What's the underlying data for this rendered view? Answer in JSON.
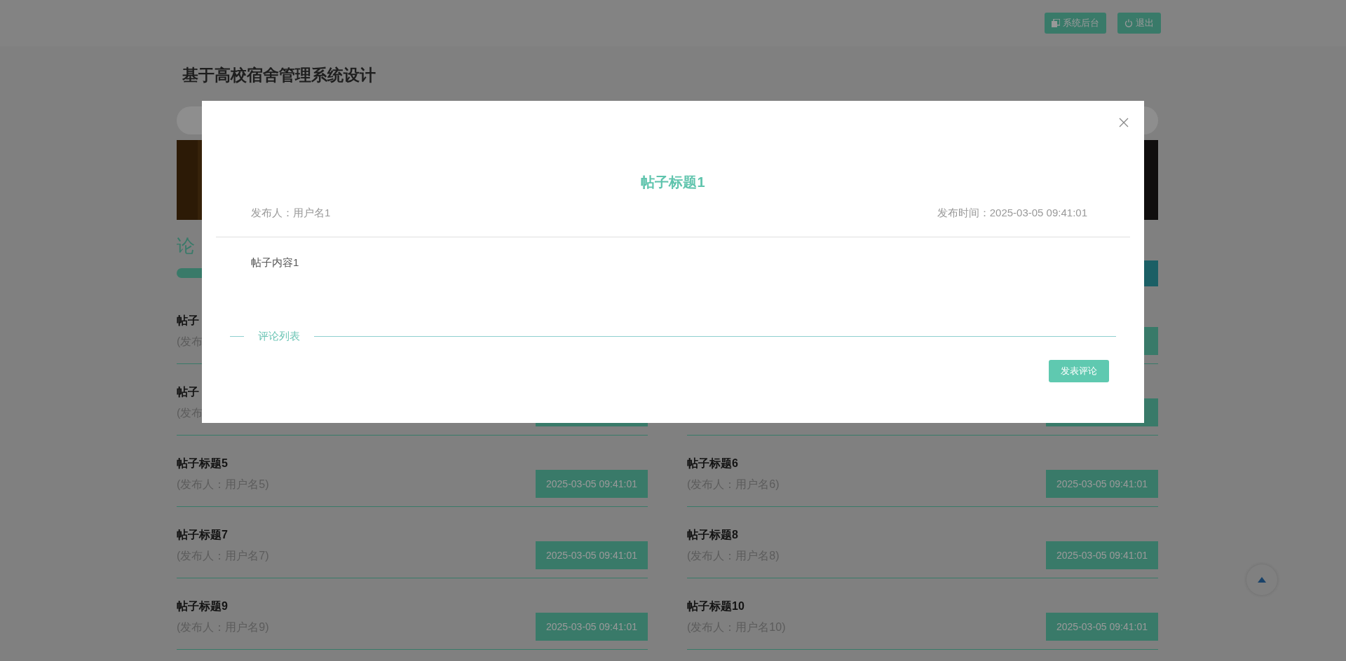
{
  "header": {
    "buttons": [
      {
        "kind": "admin",
        "label": "系统后台"
      },
      {
        "kind": "logout",
        "label": "退出"
      }
    ]
  },
  "site_title": "基于高校宿舍管理系统设计",
  "section": {
    "title": "论"
  },
  "posts": [
    {
      "kind": "post",
      "title": "帖子",
      "author": "(发布"
    },
    {
      "kind": "covered"
    },
    {
      "kind": "partial",
      "title": "帖子",
      "author": "(发布"
    },
    {
      "kind": "covered"
    },
    {
      "kind": "post",
      "title": "帖子标题5",
      "author": "(发布人：用户名5)",
      "date": "2025-03-05 09:41:01"
    },
    {
      "kind": "post",
      "title": "帖子标题6",
      "author": "(发布人：用户名6)",
      "date": "2025-03-05 09:41:01"
    },
    {
      "kind": "post",
      "title": "帖子标题7",
      "author": "(发布人：用户名7)",
      "date": "2025-03-05 09:41:01"
    },
    {
      "kind": "post",
      "title": "帖子标题8",
      "author": "(发布人：用户名8)",
      "date": "2025-03-05 09:41:01"
    },
    {
      "kind": "post",
      "title": "帖子标题9",
      "author": "(发布人：用户名9)",
      "date": "2025-03-05 09:41:01"
    },
    {
      "kind": "post",
      "title": "帖子标题10",
      "author": "(发布人：用户名10)",
      "date": "2025-03-05 09:41:01"
    }
  ],
  "modal": {
    "title": "帖子标题1",
    "author": "发布人：用户名1",
    "time": "发布时间：2025-03-05 09:41:01",
    "content": "帖子内容1",
    "comments_label": "评论列表",
    "comment_button": "发表评论"
  }
}
